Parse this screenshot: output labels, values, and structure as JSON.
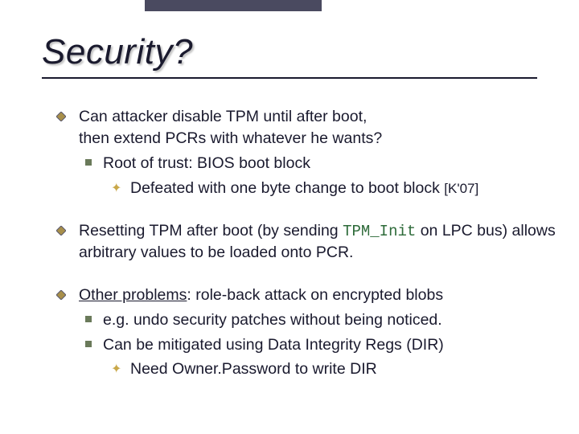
{
  "title": "Security?",
  "b1": {
    "line1": "Can attacker disable TPM until after boot,",
    "line2": "then extend PCRs with whatever he wants?",
    "sub1": "Root of trust:    BIOS boot block",
    "sub1a": "Defeated with one byte change to boot block",
    "cite": "[K'07]"
  },
  "b2": {
    "pre": "Resetting TPM after boot (by sending ",
    "mono": "TPM_Init",
    "post": " on LPC bus) allows arbitrary values to be loaded onto PCR."
  },
  "b3": {
    "label": "Other problems",
    "rest": ":     role-back attack on encrypted blobs",
    "sub1": "e.g.  undo security patches without being noticed.",
    "sub2": "Can be mitigated using Data Integrity Regs (DIR)",
    "sub2a": "Need Owner.Password to write DIR"
  },
  "colors": {
    "diamond_fill": "#a88f4a",
    "diamond_stroke": "#5a5a70"
  }
}
